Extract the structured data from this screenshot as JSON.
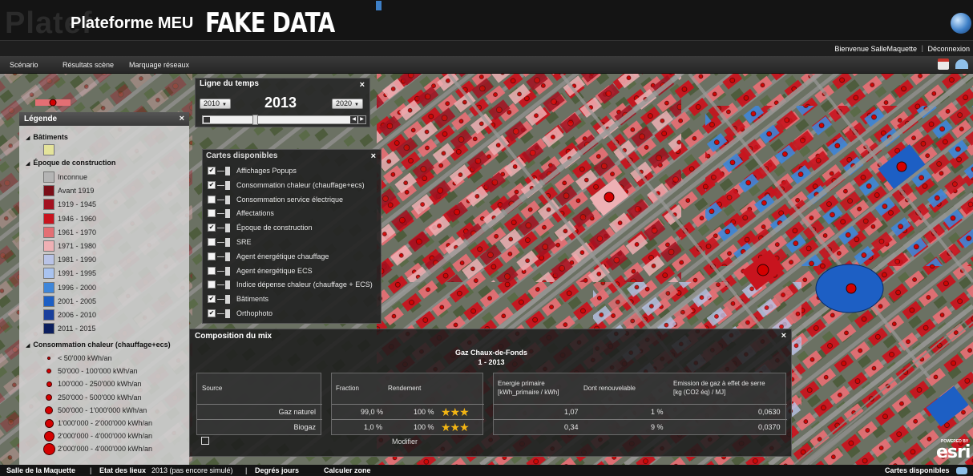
{
  "header": {
    "ghost_title": "Platef",
    "app_title": "Plateforme MEU",
    "banner": "FAKE DATA",
    "welcome": "Bienvenue SalleMaquette",
    "separator": "|",
    "logout": "Déconnexion"
  },
  "menu": {
    "items": [
      "Scénario",
      "Résultats scène",
      "Marquage réseaux"
    ]
  },
  "legend": {
    "title": "Légende",
    "close": "×",
    "sections": {
      "buildings": "Bâtiments",
      "era": "Époque de construction",
      "consumption": "Consommation chaleur (chauffage+ecs)"
    },
    "building_color": "#e4e39a",
    "era_items": [
      {
        "label": "Inconnue",
        "color": "#b4b4b4"
      },
      {
        "label": "Avant 1919",
        "color": "#7a0e18"
      },
      {
        "label": "1919 - 1945",
        "color": "#a31120"
      },
      {
        "label": "1946 - 1960",
        "color": "#c8141e"
      },
      {
        "label": "1961 - 1970",
        "color": "#e36f74"
      },
      {
        "label": "1971 - 1980",
        "color": "#eeb0b4"
      },
      {
        "label": "1981 - 1990",
        "color": "#b9c3e6"
      },
      {
        "label": "1991 - 1995",
        "color": "#a9c3ef"
      },
      {
        "label": "1996 - 2000",
        "color": "#3f86d9"
      },
      {
        "label": "2001 - 2005",
        "color": "#1d5fc4"
      },
      {
        "label": "2006 - 2010",
        "color": "#1a3f9c"
      },
      {
        "label": "2011 - 2015",
        "color": "#0c1f5e"
      }
    ],
    "consumption_items": [
      "< 50'000 kWh/an",
      "50'000 - 100'000 kWh/an",
      "100'000 - 250'000 kWh/an",
      "250'000 - 500'000 kWh/an",
      "500'000 - 1'000'000 kWh/an",
      "1'000'000 - 2'000'000 kWh/an",
      "2'000'000 - 4'000'000 kWh/an",
      "2'000'000 - 4'000'000 kWh/an"
    ]
  },
  "timeline": {
    "title": "Ligne du temps",
    "close": "×",
    "start_year": "2010",
    "current_year": "2013",
    "end_year": "2020",
    "progress": 0.3
  },
  "cartes": {
    "title": "Cartes disponibles",
    "close": "×",
    "layers": [
      {
        "label": "Affichages Popups",
        "checked": true
      },
      {
        "label": "Consommation chaleur (chauffage+ecs)",
        "checked": true
      },
      {
        "label": "Consommation service électrique",
        "checked": false
      },
      {
        "label": "Affectations",
        "checked": false
      },
      {
        "label": "Époque de construction",
        "checked": true
      },
      {
        "label": "SRE",
        "checked": false
      },
      {
        "label": "Agent énergétique chauffage",
        "checked": false
      },
      {
        "label": "Agent énergétique ECS",
        "checked": false
      },
      {
        "label": "Indice dépense chaleur (chauffage + ECS)",
        "checked": false
      },
      {
        "label": "Bâtiments",
        "checked": true
      },
      {
        "label": "Orthophoto",
        "checked": true
      }
    ]
  },
  "mix": {
    "title": "Composition du mix",
    "close": "×",
    "gas_name": "Gaz Chaux-de-Fonds",
    "period": "1 - 2013",
    "headers": {
      "source": "Source",
      "fraction": "Fraction",
      "rendement": "Rendement",
      "energie_primaire": "Energie primaire",
      "energie_primaire_unit": "[kWh_primaire / kWh]",
      "renouvelable": "Dont renouvelable",
      "emission": "Emission de gaz à effet de serre",
      "emission_unit": "[kg (CO2 éq) / MJ]"
    },
    "rows": [
      {
        "source": "Gaz naturel",
        "fraction": "99,0 %",
        "rendement": "100 %",
        "stars": 3,
        "energie": "1,07",
        "renouvelable": "1 %",
        "emission": "0,0630"
      },
      {
        "source": "Biogaz",
        "fraction": "1,0 %",
        "rendement": "100 %",
        "stars": 3,
        "energie": "0,34",
        "renouvelable": "9 %",
        "emission": "0,0370"
      }
    ],
    "modifier": "Modifier"
  },
  "esri": {
    "powered": "POWERED BY",
    "logo": "esri"
  },
  "statusbar": {
    "salle": "Salle de la Maquette",
    "sep": "|",
    "etat_label": "Etat des lieux",
    "etat_value": "2013 (pas encore simulé)",
    "degres": "Degrés jours",
    "calculer": "Calculer zone",
    "cartes": "Cartes disponibles"
  },
  "colors": {
    "accent": "#3d7fc7",
    "star": "#f2b514"
  }
}
